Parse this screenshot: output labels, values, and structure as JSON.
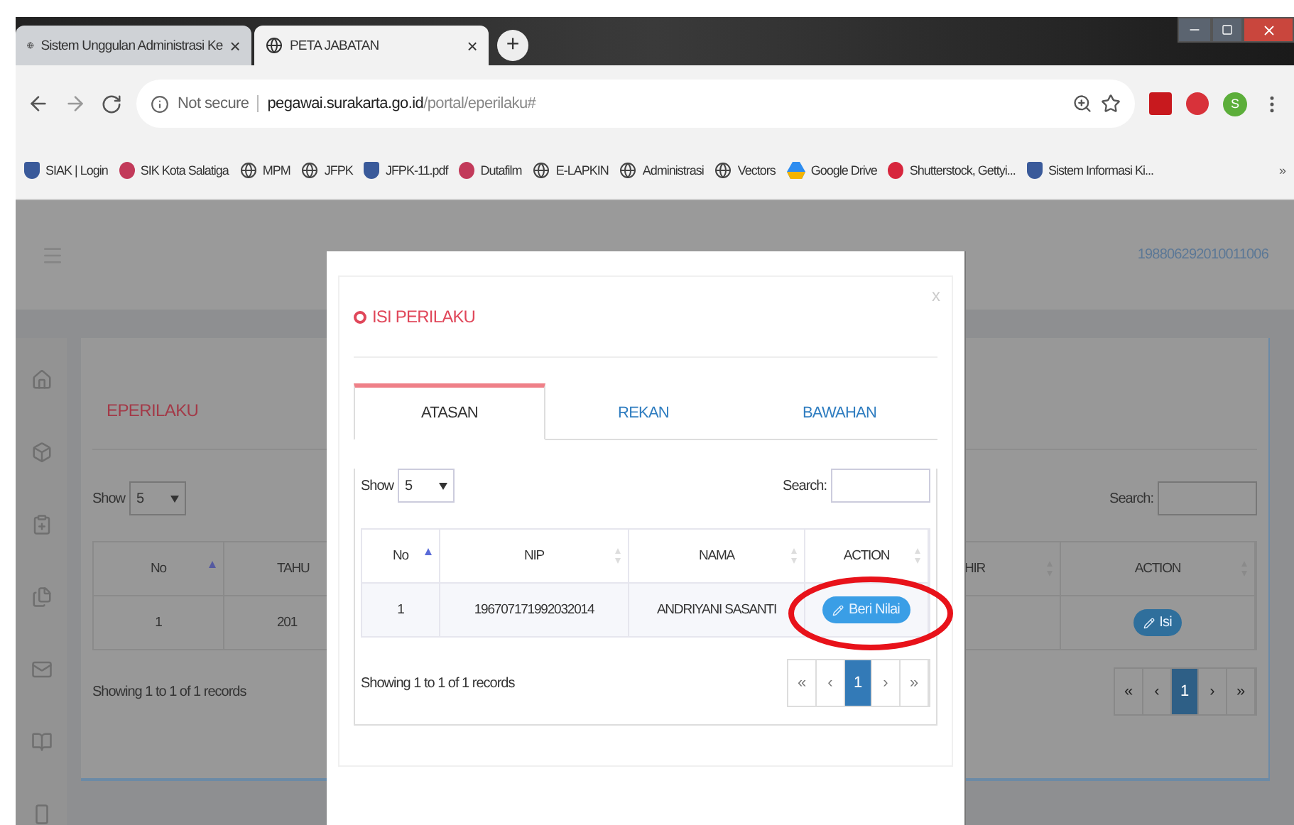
{
  "browser": {
    "tabs": [
      {
        "title": "Sistem Unggulan Administrasi Ke",
        "close": "×",
        "selected": false
      },
      {
        "title": "PETA JABATAN",
        "close": "×",
        "selected": true
      }
    ],
    "new_tab": "+",
    "address": {
      "security": "Not secure",
      "domain": "pegawai.surakarta.go.id",
      "path": "/portal/eperilaku#"
    },
    "profile": "S",
    "bookmarks": [
      {
        "label": "SIAK | Login",
        "kind": "crest"
      },
      {
        "label": "SIK Kota Salatiga",
        "kind": "loader"
      },
      {
        "label": "MPM",
        "kind": "globe"
      },
      {
        "label": "JFPK",
        "kind": "globe"
      },
      {
        "label": "JFPK-11.pdf",
        "kind": "crest"
      },
      {
        "label": "Dutafilm",
        "kind": "loader"
      },
      {
        "label": "E-LAPKIN",
        "kind": "globe"
      },
      {
        "label": "Administrasi",
        "kind": "globe"
      },
      {
        "label": "Vectors",
        "kind": "globe"
      },
      {
        "label": "Google Drive",
        "kind": "drive"
      },
      {
        "label": "Shutterstock, Gettyi...",
        "kind": "fruit"
      },
      {
        "label": "Sistem Informasi Ki...",
        "kind": "crest"
      }
    ],
    "more": "»"
  },
  "header": {
    "user_id": "198806292010011006"
  },
  "card": {
    "title": "EPERILAKU",
    "show_label": "Show",
    "show_value": "5",
    "search_label": "Search:",
    "columns": [
      {
        "label": "No",
        "sorted": true
      },
      {
        "label": "TAHU"
      },
      {
        "label": "HIR",
        "sorted": false
      },
      {
        "label": "ACTION",
        "sorted": false
      }
    ],
    "row": [
      "1",
      "201"
    ],
    "row_button": "Isi",
    "footer": "Showing 1 to 1 of 1 records",
    "pagination": [
      {
        "label": "«",
        "selected": false
      },
      {
        "label": "‹",
        "selected": false
      },
      {
        "label": "1",
        "selected": true
      },
      {
        "label": "›",
        "selected": false
      },
      {
        "label": "»",
        "selected": false
      }
    ]
  },
  "modal": {
    "title": "ISI PERILAKU",
    "close": "x",
    "tabs": [
      {
        "label": "ATASAN",
        "selected": true
      },
      {
        "label": "REKAN",
        "selected": false
      },
      {
        "label": "BAWAHAN",
        "selected": false
      }
    ],
    "show_label": "Show",
    "show_value": "5",
    "search_label": "Search:",
    "columns": [
      {
        "label": "No",
        "sorted": true
      },
      {
        "label": "NIP",
        "sorted": false
      },
      {
        "label": "NAMA",
        "sorted": false
      },
      {
        "label": "ACTION",
        "sorted": false
      }
    ],
    "row": [
      "1",
      "196707171992032014",
      "ANDRIYANI SASANTI"
    ],
    "row_button": "Beri Nilai",
    "row_button_highlighted": true,
    "footer": "Showing 1 to 1 of 1 records",
    "pagination": [
      {
        "label": "«",
        "selected": false
      },
      {
        "label": "‹",
        "selected": false
      },
      {
        "label": "1",
        "selected": true
      },
      {
        "label": "›",
        "selected": false
      },
      {
        "label": "»",
        "selected": false
      }
    ]
  }
}
